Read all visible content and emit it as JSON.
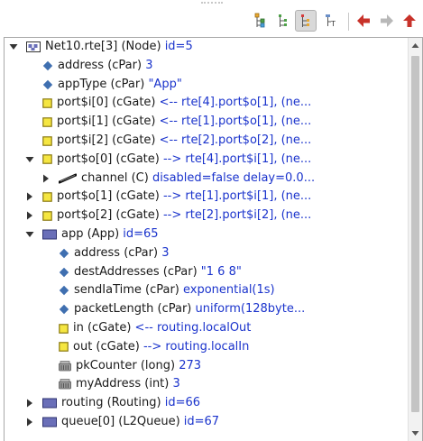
{
  "toolbar": {
    "buttons": [
      {
        "name": "tree-expand-icon",
        "active": false
      },
      {
        "name": "tree-flat-icon",
        "active": false
      },
      {
        "name": "tree-children-icon",
        "active": true
      },
      {
        "name": "tree-inherit-icon",
        "active": false
      },
      {
        "name": "back-arrow-icon",
        "active": false
      },
      {
        "name": "forward-arrow-icon",
        "active": false
      },
      {
        "name": "up-arrow-icon",
        "active": false
      }
    ]
  },
  "tree": {
    "rows": [
      {
        "level": 0,
        "expander": "open",
        "icon": "module",
        "text": "Net10.rte[3] (Node) ",
        "value": "id=5"
      },
      {
        "level": 1,
        "expander": "none",
        "icon": "diamond",
        "text": "address (cPar) ",
        "value": "3"
      },
      {
        "level": 1,
        "expander": "none",
        "icon": "diamond",
        "text": "appType (cPar) ",
        "value": "\"App\""
      },
      {
        "level": 1,
        "expander": "none",
        "icon": "gate",
        "text": "port$i[0] (cGate) ",
        "value": "<-- rte[4].port$o[1], (ne..."
      },
      {
        "level": 1,
        "expander": "none",
        "icon": "gate",
        "text": "port$i[1] (cGate) ",
        "value": "<-- rte[1].port$o[1], (ne..."
      },
      {
        "level": 1,
        "expander": "none",
        "icon": "gate",
        "text": "port$i[2] (cGate) ",
        "value": "<-- rte[2].port$o[2], (ne..."
      },
      {
        "level": 1,
        "expander": "open",
        "icon": "gate",
        "text": "port$o[0] (cGate) ",
        "value": "--> rte[4].port$i[1], (ne..."
      },
      {
        "level": 2,
        "expander": "closed",
        "icon": "channel",
        "text": "channel (C) ",
        "value": "disabled=false delay=0.0..."
      },
      {
        "level": 1,
        "expander": "closed",
        "icon": "gate",
        "text": "port$o[1] (cGate) ",
        "value": "--> rte[1].port$i[1], (ne..."
      },
      {
        "level": 1,
        "expander": "closed",
        "icon": "gate",
        "text": "port$o[2] (cGate) ",
        "value": "--> rte[2].port$i[2], (ne..."
      },
      {
        "level": 1,
        "expander": "open",
        "icon": "submodule",
        "text": "app (App) ",
        "value": "id=65"
      },
      {
        "level": 2,
        "expander": "none",
        "icon": "diamond",
        "text": "address (cPar) ",
        "value": "3"
      },
      {
        "level": 2,
        "expander": "none",
        "icon": "diamond",
        "text": "destAddresses (cPar) ",
        "value": "\"1 6 8\""
      },
      {
        "level": 2,
        "expander": "none",
        "icon": "diamond",
        "text": "sendIaTime (cPar) ",
        "value": "exponential(1s)"
      },
      {
        "level": 2,
        "expander": "none",
        "icon": "diamond",
        "text": "packetLength (cPar) ",
        "value": "uniform(128byte..."
      },
      {
        "level": 2,
        "expander": "none",
        "icon": "gate",
        "text": "in (cGate) ",
        "value": "<-- routing.localOut"
      },
      {
        "level": 2,
        "expander": "none",
        "icon": "gate",
        "text": "out (cGate) ",
        "value": "--> routing.localIn"
      },
      {
        "level": 2,
        "expander": "none",
        "icon": "watch",
        "text": "pkCounter (long) ",
        "value": "273"
      },
      {
        "level": 2,
        "expander": "none",
        "icon": "watch",
        "text": "myAddress (int) ",
        "value": "3"
      },
      {
        "level": 1,
        "expander": "closed",
        "icon": "submodule",
        "text": "routing (Routing) ",
        "value": "id=66"
      },
      {
        "level": 1,
        "expander": "closed",
        "icon": "submodule",
        "text": "queue[0] (L2Queue) ",
        "value": "id=67"
      }
    ]
  },
  "colors": {
    "value": "#1a33cc",
    "gate_fill": "#f5e642",
    "gate_border": "#8a7a10",
    "diamond": "#3f6fb0",
    "module": "#6a6fb8"
  }
}
